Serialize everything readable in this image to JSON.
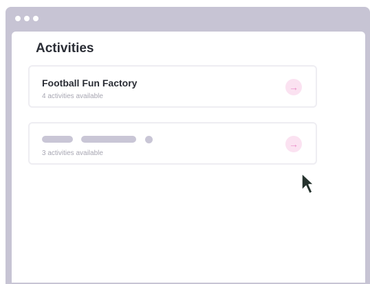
{
  "page": {
    "title": "Activities"
  },
  "activities": [
    {
      "name": "Football Fun Factory",
      "subtitle": "4 activities available"
    },
    {
      "name": "",
      "subtitle": "3 activities available"
    }
  ],
  "icons": {
    "arrow": "arrow-right-icon",
    "cursor": "mouse-pointer-icon",
    "arrow_glyph": "→"
  },
  "colors": {
    "window_frame": "#c7c4d4",
    "arrow_bg": "#fbe2f1",
    "arrow_fg": "#ea8cc8",
    "skeleton": "#c9c6d6",
    "text": "#2a2d35",
    "muted_text": "#a7a6b2"
  }
}
